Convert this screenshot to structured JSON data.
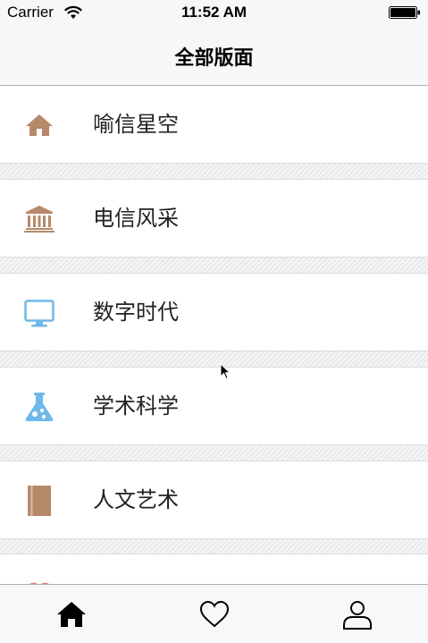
{
  "status_bar": {
    "carrier": "Carrier",
    "time": "11:52 AM"
  },
  "nav": {
    "title": "全部版面"
  },
  "sections": [
    {
      "label": "喻信星空",
      "icon": "home-icon",
      "color": "#b5896a"
    },
    {
      "label": "电信风采",
      "icon": "bank-icon",
      "color": "#b5896a"
    },
    {
      "label": "数字时代",
      "icon": "monitor-icon",
      "color": "#6fb8ea"
    },
    {
      "label": "学术科学",
      "icon": "flask-icon",
      "color": "#6fb8ea"
    },
    {
      "label": "人文艺术",
      "icon": "book-icon",
      "color": "#b5896a"
    },
    {
      "label": "",
      "icon": "heart-icon",
      "color": "#e27a7a"
    }
  ],
  "tabs": [
    {
      "name": "home",
      "icon": "home-icon",
      "selected": true
    },
    {
      "name": "favorites",
      "icon": "heart-icon",
      "selected": false
    },
    {
      "name": "profile",
      "icon": "person-icon",
      "selected": false
    }
  ],
  "colors": {
    "brown_accent": "#b5896a",
    "blue_accent": "#6fb8ea",
    "pink_accent": "#e27a7a"
  }
}
